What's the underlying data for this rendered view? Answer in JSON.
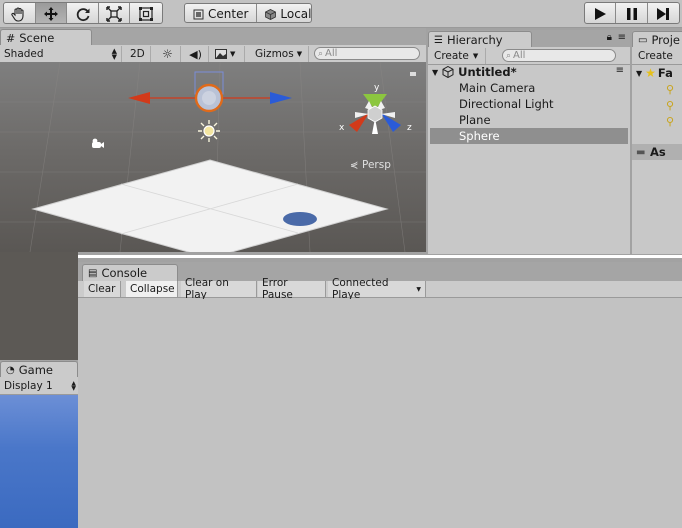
{
  "toolbar": {
    "tools": [
      "hand-tool",
      "move-tool",
      "rotate-tool",
      "scale-tool",
      "rect-tool"
    ],
    "pivot_label": "Center",
    "space_label": "Local"
  },
  "scene": {
    "tab_label": "Scene",
    "shading_mode": "Shaded",
    "mode_2d": "2D",
    "gizmos_label": "Gizmos",
    "search_placeholder": "All",
    "persp_label": "Persp",
    "axes": {
      "x": "x",
      "y": "y",
      "z": "z"
    }
  },
  "hierarchy": {
    "tab_label": "Hierarchy",
    "create_label": "Create",
    "search_placeholder": "All",
    "scene_name": "Untitled*",
    "items": [
      {
        "label": "Main Camera",
        "selected": false
      },
      {
        "label": "Directional Light",
        "selected": false
      },
      {
        "label": "Plane",
        "selected": false
      },
      {
        "label": "Sphere",
        "selected": true
      }
    ]
  },
  "project": {
    "tab_label": "Proje",
    "create_label": "Create",
    "favorites_label": "Fa",
    "assets_label": "As"
  },
  "console": {
    "tab_label": "Console",
    "buttons": {
      "clear": "Clear",
      "collapse": "Collapse",
      "clear_on_play": "Clear on Play",
      "error_pause": "Error Pause",
      "connected_player": "Connected Playe"
    }
  },
  "game": {
    "tab_label": "Game",
    "display_label": "Display 1"
  },
  "colors": {
    "selection": "#8f8f8f",
    "game_sky": "#4a77c9",
    "x_axis": "#d23a1a",
    "y_axis": "#8cc63f",
    "z_axis": "#2a5bd7"
  }
}
